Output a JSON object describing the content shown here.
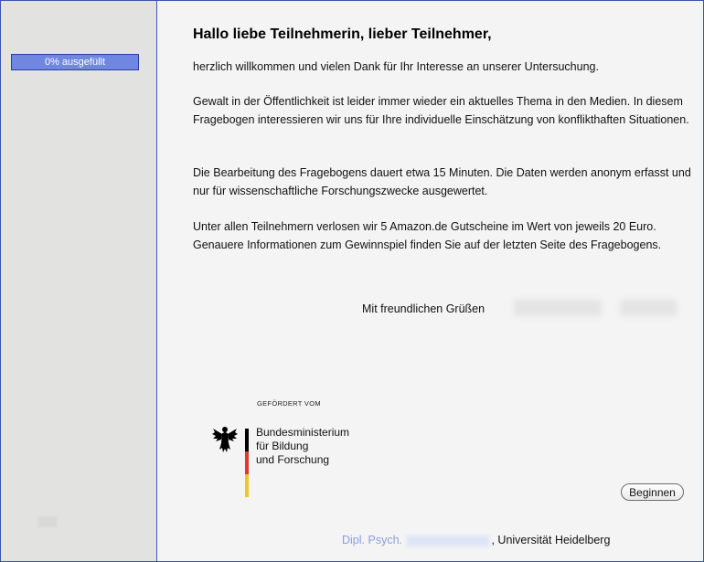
{
  "sidebar": {
    "progress_label": "0% ausgefüllt"
  },
  "main": {
    "greeting": "Hallo liebe Teilnehmerin, lieber Teilnehmer,",
    "paragraphs": [
      "herzlich willkommen und vielen Dank für Ihr Interesse an unserer Untersuchung.",
      "Gewalt in der Öffentlichkeit ist leider immer wieder ein aktuelles Thema in den Medien. In diesem Fragebogen interessieren wir uns für Ihre individuelle Einschätzung von konflikthaften Situationen.",
      "Die Bearbeitung des Fragebogens dauert etwa 15 Minuten. Die Daten werden anonym erfasst und nur für wissenschaftliche Forschungszwecke ausgewertet.",
      "Unter allen Teilnehmern verlosen wir 5 Amazon.de Gutscheine im Wert von jeweils 20 Euro. Genauere Informationen zum Gewinnspiel finden Sie auf der letzten Seite des Fragebogens."
    ],
    "closing": "Mit freundlichen Grüßen",
    "logo": {
      "funded_by": "GEFÖRDERT VOM",
      "ministry_lines": [
        "Bundesministerium",
        "für Bildung",
        "und Forschung"
      ],
      "flag_colors": [
        "#000000",
        "#dd3a2a",
        "#f2c230"
      ],
      "icon": "federal-eagle-icon"
    },
    "begin_button": "Beginnen",
    "footer": {
      "title": "Dipl. Psych.",
      "affiliation": ", Universität Heidelberg"
    }
  },
  "colors": {
    "frame_border": "#3a55a8",
    "progress_fill": "#6f87e0",
    "sidebar_bg": "#e2e3e1",
    "content_bg": "#f4f4f4",
    "footer_title": "#8a9ee0"
  }
}
